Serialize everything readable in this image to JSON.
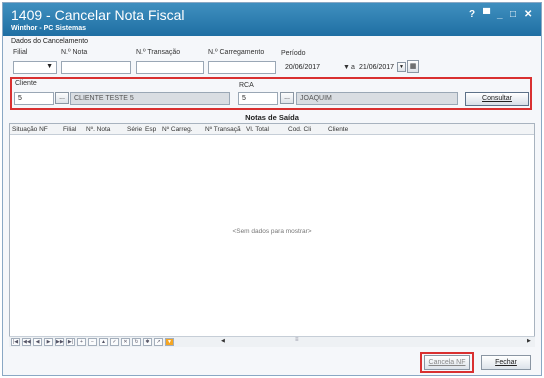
{
  "window": {
    "title": "1409 - Cancelar Nota Fiscal",
    "subtitle": "Winthor - PC Sistemas",
    "controls": [
      "?",
      "▀",
      "_",
      "□",
      "✕"
    ]
  },
  "filters": {
    "group_label": "Dados do Cancelamento",
    "filial_label": "Filial",
    "filial_value": "",
    "nota_label": "N.º Nota",
    "nota_value": "",
    "transacao_label": "N.º Transação",
    "transacao_value": "",
    "carregamento_label": "N.º Carregamento",
    "carregamento_value": "",
    "periodo_label": "Período",
    "periodo_start": "20/06/2017",
    "periodo_sep": "a",
    "periodo_end": "21/06/2017"
  },
  "cliente": {
    "label": "Cliente",
    "code": "5",
    "lookup_button": "...",
    "name": "CLIENTE TESTE 5"
  },
  "rca": {
    "label": "RCA",
    "code": "5",
    "lookup_button": "...",
    "name": "JOAQUIM"
  },
  "consultar_button": "Consultar",
  "grid": {
    "title": "Notas de Saída",
    "columns": [
      "Situação NF",
      "Filial",
      "Nº. Nota",
      "Série",
      "Esp",
      "Nº Carreg.",
      "Nº Transaçã",
      "Vl. Total",
      "Cod. Cli",
      "Cliente"
    ],
    "empty_message": "<Sem dados para mostrar>"
  },
  "buttons": {
    "cancela_nf": "Cancela NF",
    "fechar": "Fechar"
  },
  "colors": {
    "titlebar": "#2a7db2",
    "highlight": "#d93030"
  }
}
